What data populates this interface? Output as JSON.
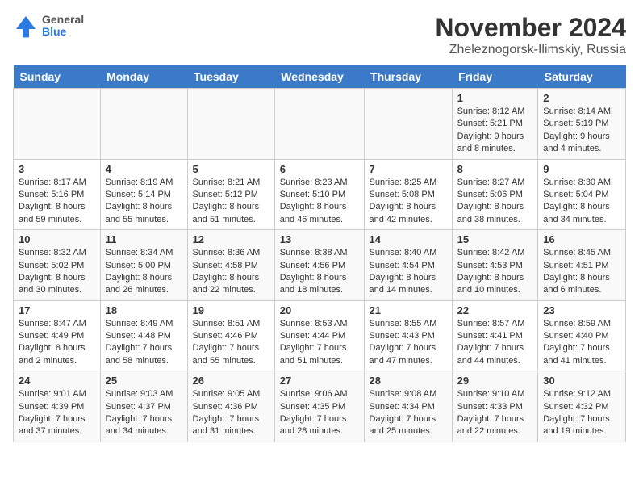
{
  "header": {
    "logo_general": "General",
    "logo_blue": "Blue",
    "title": "November 2024",
    "location": "Zheleznogorsk-Ilimskiy, Russia"
  },
  "days_of_week": [
    "Sunday",
    "Monday",
    "Tuesday",
    "Wednesday",
    "Thursday",
    "Friday",
    "Saturday"
  ],
  "weeks": [
    [
      {
        "day": "",
        "info": ""
      },
      {
        "day": "",
        "info": ""
      },
      {
        "day": "",
        "info": ""
      },
      {
        "day": "",
        "info": ""
      },
      {
        "day": "",
        "info": ""
      },
      {
        "day": "1",
        "info": "Sunrise: 8:12 AM\nSunset: 5:21 PM\nDaylight: 9 hours and 8 minutes."
      },
      {
        "day": "2",
        "info": "Sunrise: 8:14 AM\nSunset: 5:19 PM\nDaylight: 9 hours and 4 minutes."
      }
    ],
    [
      {
        "day": "3",
        "info": "Sunrise: 8:17 AM\nSunset: 5:16 PM\nDaylight: 8 hours and 59 minutes."
      },
      {
        "day": "4",
        "info": "Sunrise: 8:19 AM\nSunset: 5:14 PM\nDaylight: 8 hours and 55 minutes."
      },
      {
        "day": "5",
        "info": "Sunrise: 8:21 AM\nSunset: 5:12 PM\nDaylight: 8 hours and 51 minutes."
      },
      {
        "day": "6",
        "info": "Sunrise: 8:23 AM\nSunset: 5:10 PM\nDaylight: 8 hours and 46 minutes."
      },
      {
        "day": "7",
        "info": "Sunrise: 8:25 AM\nSunset: 5:08 PM\nDaylight: 8 hours and 42 minutes."
      },
      {
        "day": "8",
        "info": "Sunrise: 8:27 AM\nSunset: 5:06 PM\nDaylight: 8 hours and 38 minutes."
      },
      {
        "day": "9",
        "info": "Sunrise: 8:30 AM\nSunset: 5:04 PM\nDaylight: 8 hours and 34 minutes."
      }
    ],
    [
      {
        "day": "10",
        "info": "Sunrise: 8:32 AM\nSunset: 5:02 PM\nDaylight: 8 hours and 30 minutes."
      },
      {
        "day": "11",
        "info": "Sunrise: 8:34 AM\nSunset: 5:00 PM\nDaylight: 8 hours and 26 minutes."
      },
      {
        "day": "12",
        "info": "Sunrise: 8:36 AM\nSunset: 4:58 PM\nDaylight: 8 hours and 22 minutes."
      },
      {
        "day": "13",
        "info": "Sunrise: 8:38 AM\nSunset: 4:56 PM\nDaylight: 8 hours and 18 minutes."
      },
      {
        "day": "14",
        "info": "Sunrise: 8:40 AM\nSunset: 4:54 PM\nDaylight: 8 hours and 14 minutes."
      },
      {
        "day": "15",
        "info": "Sunrise: 8:42 AM\nSunset: 4:53 PM\nDaylight: 8 hours and 10 minutes."
      },
      {
        "day": "16",
        "info": "Sunrise: 8:45 AM\nSunset: 4:51 PM\nDaylight: 8 hours and 6 minutes."
      }
    ],
    [
      {
        "day": "17",
        "info": "Sunrise: 8:47 AM\nSunset: 4:49 PM\nDaylight: 8 hours and 2 minutes."
      },
      {
        "day": "18",
        "info": "Sunrise: 8:49 AM\nSunset: 4:48 PM\nDaylight: 7 hours and 58 minutes."
      },
      {
        "day": "19",
        "info": "Sunrise: 8:51 AM\nSunset: 4:46 PM\nDaylight: 7 hours and 55 minutes."
      },
      {
        "day": "20",
        "info": "Sunrise: 8:53 AM\nSunset: 4:44 PM\nDaylight: 7 hours and 51 minutes."
      },
      {
        "day": "21",
        "info": "Sunrise: 8:55 AM\nSunset: 4:43 PM\nDaylight: 7 hours and 47 minutes."
      },
      {
        "day": "22",
        "info": "Sunrise: 8:57 AM\nSunset: 4:41 PM\nDaylight: 7 hours and 44 minutes."
      },
      {
        "day": "23",
        "info": "Sunrise: 8:59 AM\nSunset: 4:40 PM\nDaylight: 7 hours and 41 minutes."
      }
    ],
    [
      {
        "day": "24",
        "info": "Sunrise: 9:01 AM\nSunset: 4:39 PM\nDaylight: 7 hours and 37 minutes."
      },
      {
        "day": "25",
        "info": "Sunrise: 9:03 AM\nSunset: 4:37 PM\nDaylight: 7 hours and 34 minutes."
      },
      {
        "day": "26",
        "info": "Sunrise: 9:05 AM\nSunset: 4:36 PM\nDaylight: 7 hours and 31 minutes."
      },
      {
        "day": "27",
        "info": "Sunrise: 9:06 AM\nSunset: 4:35 PM\nDaylight: 7 hours and 28 minutes."
      },
      {
        "day": "28",
        "info": "Sunrise: 9:08 AM\nSunset: 4:34 PM\nDaylight: 7 hours and 25 minutes."
      },
      {
        "day": "29",
        "info": "Sunrise: 9:10 AM\nSunset: 4:33 PM\nDaylight: 7 hours and 22 minutes."
      },
      {
        "day": "30",
        "info": "Sunrise: 9:12 AM\nSunset: 4:32 PM\nDaylight: 7 hours and 19 minutes."
      }
    ]
  ]
}
